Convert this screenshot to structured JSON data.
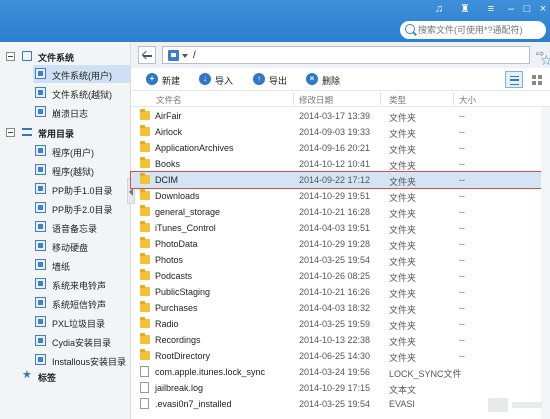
{
  "search": {
    "placeholder": "搜索文件(可使用*?通配符)"
  },
  "titlebar_icons": [
    "music-icon",
    "shirt-icon",
    "menu-icon",
    "minimize-icon",
    "maximize-icon",
    "close-icon"
  ],
  "sidebar": {
    "sections": [
      {
        "label": "文件系统",
        "icon": "monitor-icon",
        "items": [
          {
            "label": "文件系统(用户)",
            "selected": true
          },
          {
            "label": "文件系统(越狱)"
          },
          {
            "label": "崩溃日志"
          }
        ]
      },
      {
        "label": "常用目录",
        "icon": "list-icon",
        "items": [
          {
            "label": "程序(用户)"
          },
          {
            "label": "程序(越狱)"
          },
          {
            "label": "PP助手1.0目录"
          },
          {
            "label": "PP助手2.0目录"
          },
          {
            "label": "语音备忘录"
          },
          {
            "label": "移动硬盘"
          },
          {
            "label": "墙纸"
          },
          {
            "label": "系统来电铃声"
          },
          {
            "label": "系统短信铃声"
          },
          {
            "label": "PXL垃圾目录"
          },
          {
            "label": "Cydia安装目录"
          },
          {
            "label": "Installous安装目录"
          }
        ]
      },
      {
        "label": "标签",
        "icon": "star-icon",
        "items": []
      }
    ]
  },
  "address": {
    "path": "/"
  },
  "toolbar": {
    "new_label": "新建",
    "import_label": "导入",
    "export_label": "导出",
    "delete_label": "删除"
  },
  "columns": {
    "name": "文件名",
    "modified": "修改日期",
    "type": "类型",
    "size": "大小"
  },
  "rows": [
    {
      "name": "AirFair",
      "modified": "2014-03-17 13:39",
      "type": "文件夹",
      "size": "--",
      "kind": "folder"
    },
    {
      "name": "Airlock",
      "modified": "2014-09-03 19:33",
      "type": "文件夹",
      "size": "--",
      "kind": "folder"
    },
    {
      "name": "ApplicationArchives",
      "modified": "2014-09-16 20:21",
      "type": "文件夹",
      "size": "--",
      "kind": "folder"
    },
    {
      "name": "Books",
      "modified": "2014-10-12 10:41",
      "type": "文件夹",
      "size": "--",
      "kind": "folder"
    },
    {
      "name": "DCIM",
      "modified": "2014-09-22 17:12",
      "type": "文件夹",
      "size": "--",
      "kind": "folder",
      "selected": true
    },
    {
      "name": "Downloads",
      "modified": "2014-10-29 19:51",
      "type": "文件夹",
      "size": "--",
      "kind": "folder"
    },
    {
      "name": "general_storage",
      "modified": "2014-10-21 16:28",
      "type": "文件夹",
      "size": "--",
      "kind": "folder"
    },
    {
      "name": "iTunes_Control",
      "modified": "2014-04-03 19:51",
      "type": "文件夹",
      "size": "--",
      "kind": "folder"
    },
    {
      "name": "PhotoData",
      "modified": "2014-10-29 19:28",
      "type": "文件夹",
      "size": "--",
      "kind": "folder"
    },
    {
      "name": "Photos",
      "modified": "2014-03-25 19:54",
      "type": "文件夹",
      "size": "--",
      "kind": "folder"
    },
    {
      "name": "Podcasts",
      "modified": "2014-10-26 08:25",
      "type": "文件夹",
      "size": "--",
      "kind": "folder"
    },
    {
      "name": "PublicStaging",
      "modified": "2014-10-21 16:26",
      "type": "文件夹",
      "size": "--",
      "kind": "folder"
    },
    {
      "name": "Purchases",
      "modified": "2014-04-03 18:32",
      "type": "文件夹",
      "size": "--",
      "kind": "folder"
    },
    {
      "name": "Radio",
      "modified": "2014-03-25 19:59",
      "type": "文件夹",
      "size": "--",
      "kind": "folder"
    },
    {
      "name": "Recordings",
      "modified": "2014-10-13 22:38",
      "type": "文件夹",
      "size": "--",
      "kind": "folder"
    },
    {
      "name": "RootDirectory",
      "modified": "2014-06-25 14:30",
      "type": "文件夹",
      "size": "--",
      "kind": "folder"
    },
    {
      "name": "com.apple.itunes.lock_sync",
      "modified": "2014-03-24 19:56",
      "type": "LOCK_SYNC文件",
      "size": "",
      "kind": "file"
    },
    {
      "name": "jailbreak.log",
      "modified": "2014-10-29 17:15",
      "type": "文本文",
      "size": "",
      "kind": "file"
    },
    {
      "name": ".evasi0n7_installed",
      "modified": "2014-03-25 19:54",
      "type": "EVASI",
      "size": "",
      "kind": "file"
    }
  ]
}
